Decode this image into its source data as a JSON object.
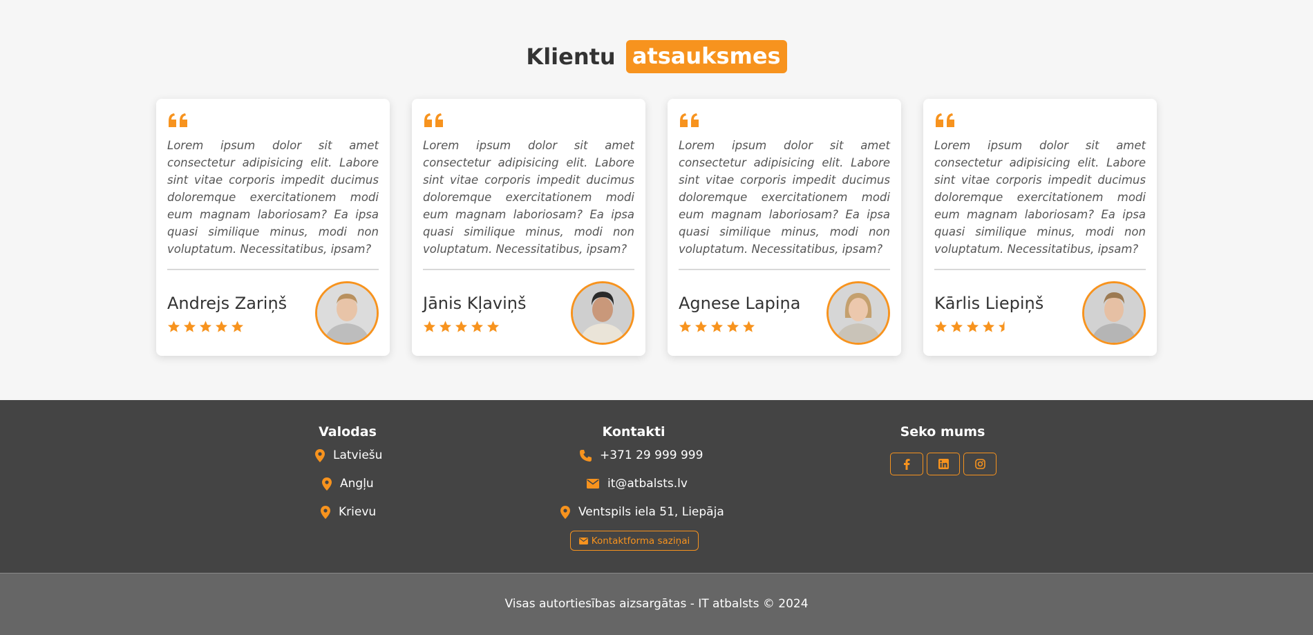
{
  "section": {
    "title_plain": "Klientu",
    "title_highlight": "atsauksmes"
  },
  "testimonials": [
    {
      "quote": "Lorem ipsum dolor sit amet consectetur adipisicing elit. Labore sint vitae corporis impedit ducimus doloremque exercitationem modi eum magnam laboriosam? Ea ipsa quasi similique minus, modi non voluptatum. Necessitatibus, ipsam?",
      "name": "Andrejs Zariņš",
      "rating": 5
    },
    {
      "quote": "Lorem ipsum dolor sit amet consectetur adipisicing elit. Labore sint vitae corporis impedit ducimus doloremque exercitationem modi eum magnam laboriosam? Ea ipsa quasi similique minus, modi non voluptatum. Necessitatibus, ipsam?",
      "name": "Jānis Kļaviņš",
      "rating": 5
    },
    {
      "quote": "Lorem ipsum dolor sit amet consectetur adipisicing elit. Labore sint vitae corporis impedit ducimus doloremque exercitationem modi eum magnam laboriosam? Ea ipsa quasi similique minus, modi non voluptatum. Necessitatibus, ipsam?",
      "name": "Agnese Lapiņa",
      "rating": 5
    },
    {
      "quote": "Lorem ipsum dolor sit amet consectetur adipisicing elit. Labore sint vitae corporis impedit ducimus doloremque exercitationem modi eum magnam laboriosam? Ea ipsa quasi similique minus, modi non voluptatum. Necessitatibus, ipsam?",
      "name": "Kārlis Liepiņš",
      "rating": 4.5
    }
  ],
  "footer": {
    "languages": {
      "title": "Valodas",
      "items": [
        "Latviešu",
        "Angļu",
        "Krievu"
      ]
    },
    "contacts": {
      "title": "Kontakti",
      "phone": "+371 29 999 999",
      "email": "it@atbalsts.lv",
      "address": "Ventspils iela 51, Liepāja",
      "form_button": "Kontaktforma saziņai"
    },
    "follow": {
      "title": "Seko mums",
      "icons": [
        "facebook-icon",
        "linkedin-icon",
        "instagram-icon"
      ]
    },
    "copyright": "Visas autortiesības aizsargātas - IT atbalsts © 2024"
  },
  "colors": {
    "accent": "#f7931e",
    "footer_bg": "#444444",
    "bottom_bar_bg": "#666666",
    "page_bg": "#f6f6f6"
  }
}
